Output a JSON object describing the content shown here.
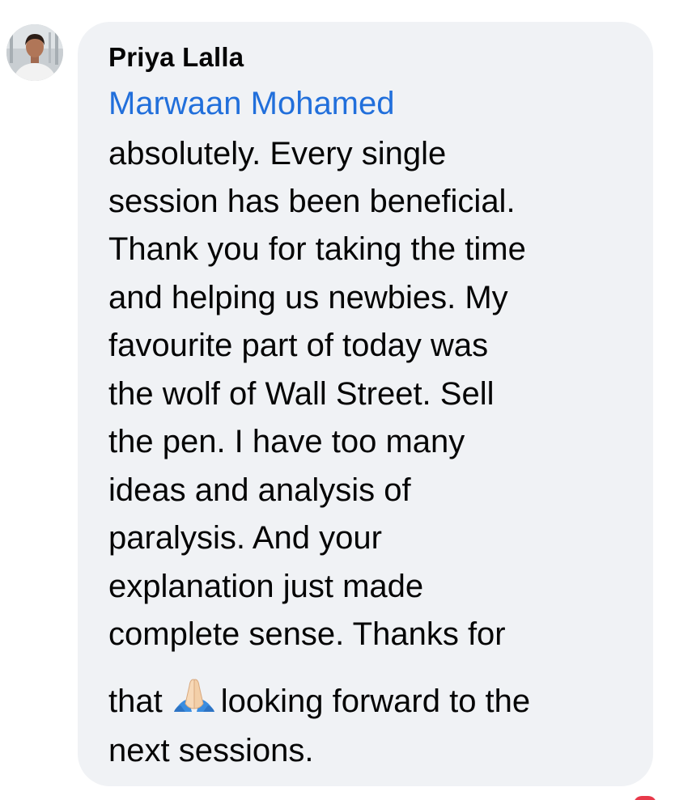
{
  "comment": {
    "author": "Priya Lalla",
    "mention": "Marwaan Mohamed",
    "lines": [
      "absolutely. Every single",
      "session has been beneficial.",
      "Thank you for taking the time",
      "and helping us newbies. My",
      "favourite part of today was",
      "the wolf of Wall Street. Sell",
      "the pen. I have too many",
      "ideas and analysis of",
      "paralysis. And your",
      "explanation just made",
      "complete sense. Thanks for"
    ],
    "last_line_start": "that",
    "emoji_icon": "folded-hands-icon",
    "last_line_end": "looking forward to the",
    "final_line": "next sessions."
  },
  "colors": {
    "bubble": "#f0f2f5",
    "mention": "#216fdb",
    "text": "#050505"
  }
}
